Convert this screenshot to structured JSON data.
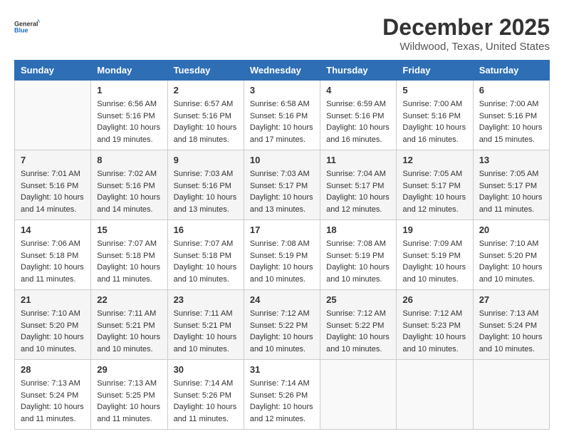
{
  "logo": {
    "line1": "General",
    "line2": "Blue"
  },
  "title": "December 2025",
  "location": "Wildwood, Texas, United States",
  "weekdays": [
    "Sunday",
    "Monday",
    "Tuesday",
    "Wednesday",
    "Thursday",
    "Friday",
    "Saturday"
  ],
  "weeks": [
    [
      {
        "day": "",
        "info": ""
      },
      {
        "day": "1",
        "info": "Sunrise: 6:56 AM\nSunset: 5:16 PM\nDaylight: 10 hours\nand 19 minutes."
      },
      {
        "day": "2",
        "info": "Sunrise: 6:57 AM\nSunset: 5:16 PM\nDaylight: 10 hours\nand 18 minutes."
      },
      {
        "day": "3",
        "info": "Sunrise: 6:58 AM\nSunset: 5:16 PM\nDaylight: 10 hours\nand 17 minutes."
      },
      {
        "day": "4",
        "info": "Sunrise: 6:59 AM\nSunset: 5:16 PM\nDaylight: 10 hours\nand 16 minutes."
      },
      {
        "day": "5",
        "info": "Sunrise: 7:00 AM\nSunset: 5:16 PM\nDaylight: 10 hours\nand 16 minutes."
      },
      {
        "day": "6",
        "info": "Sunrise: 7:00 AM\nSunset: 5:16 PM\nDaylight: 10 hours\nand 15 minutes."
      }
    ],
    [
      {
        "day": "7",
        "info": "Sunrise: 7:01 AM\nSunset: 5:16 PM\nDaylight: 10 hours\nand 14 minutes."
      },
      {
        "day": "8",
        "info": "Sunrise: 7:02 AM\nSunset: 5:16 PM\nDaylight: 10 hours\nand 14 minutes."
      },
      {
        "day": "9",
        "info": "Sunrise: 7:03 AM\nSunset: 5:16 PM\nDaylight: 10 hours\nand 13 minutes."
      },
      {
        "day": "10",
        "info": "Sunrise: 7:03 AM\nSunset: 5:17 PM\nDaylight: 10 hours\nand 13 minutes."
      },
      {
        "day": "11",
        "info": "Sunrise: 7:04 AM\nSunset: 5:17 PM\nDaylight: 10 hours\nand 12 minutes."
      },
      {
        "day": "12",
        "info": "Sunrise: 7:05 AM\nSunset: 5:17 PM\nDaylight: 10 hours\nand 12 minutes."
      },
      {
        "day": "13",
        "info": "Sunrise: 7:05 AM\nSunset: 5:17 PM\nDaylight: 10 hours\nand 11 minutes."
      }
    ],
    [
      {
        "day": "14",
        "info": "Sunrise: 7:06 AM\nSunset: 5:18 PM\nDaylight: 10 hours\nand 11 minutes."
      },
      {
        "day": "15",
        "info": "Sunrise: 7:07 AM\nSunset: 5:18 PM\nDaylight: 10 hours\nand 11 minutes."
      },
      {
        "day": "16",
        "info": "Sunrise: 7:07 AM\nSunset: 5:18 PM\nDaylight: 10 hours\nand 10 minutes."
      },
      {
        "day": "17",
        "info": "Sunrise: 7:08 AM\nSunset: 5:19 PM\nDaylight: 10 hours\nand 10 minutes."
      },
      {
        "day": "18",
        "info": "Sunrise: 7:08 AM\nSunset: 5:19 PM\nDaylight: 10 hours\nand 10 minutes."
      },
      {
        "day": "19",
        "info": "Sunrise: 7:09 AM\nSunset: 5:19 PM\nDaylight: 10 hours\nand 10 minutes."
      },
      {
        "day": "20",
        "info": "Sunrise: 7:10 AM\nSunset: 5:20 PM\nDaylight: 10 hours\nand 10 minutes."
      }
    ],
    [
      {
        "day": "21",
        "info": "Sunrise: 7:10 AM\nSunset: 5:20 PM\nDaylight: 10 hours\nand 10 minutes."
      },
      {
        "day": "22",
        "info": "Sunrise: 7:11 AM\nSunset: 5:21 PM\nDaylight: 10 hours\nand 10 minutes."
      },
      {
        "day": "23",
        "info": "Sunrise: 7:11 AM\nSunset: 5:21 PM\nDaylight: 10 hours\nand 10 minutes."
      },
      {
        "day": "24",
        "info": "Sunrise: 7:12 AM\nSunset: 5:22 PM\nDaylight: 10 hours\nand 10 minutes."
      },
      {
        "day": "25",
        "info": "Sunrise: 7:12 AM\nSunset: 5:22 PM\nDaylight: 10 hours\nand 10 minutes."
      },
      {
        "day": "26",
        "info": "Sunrise: 7:12 AM\nSunset: 5:23 PM\nDaylight: 10 hours\nand 10 minutes."
      },
      {
        "day": "27",
        "info": "Sunrise: 7:13 AM\nSunset: 5:24 PM\nDaylight: 10 hours\nand 10 minutes."
      }
    ],
    [
      {
        "day": "28",
        "info": "Sunrise: 7:13 AM\nSunset: 5:24 PM\nDaylight: 10 hours\nand 11 minutes."
      },
      {
        "day": "29",
        "info": "Sunrise: 7:13 AM\nSunset: 5:25 PM\nDaylight: 10 hours\nand 11 minutes."
      },
      {
        "day": "30",
        "info": "Sunrise: 7:14 AM\nSunset: 5:26 PM\nDaylight: 10 hours\nand 11 minutes."
      },
      {
        "day": "31",
        "info": "Sunrise: 7:14 AM\nSunset: 5:26 PM\nDaylight: 10 hours\nand 12 minutes."
      },
      {
        "day": "",
        "info": ""
      },
      {
        "day": "",
        "info": ""
      },
      {
        "day": "",
        "info": ""
      }
    ]
  ]
}
